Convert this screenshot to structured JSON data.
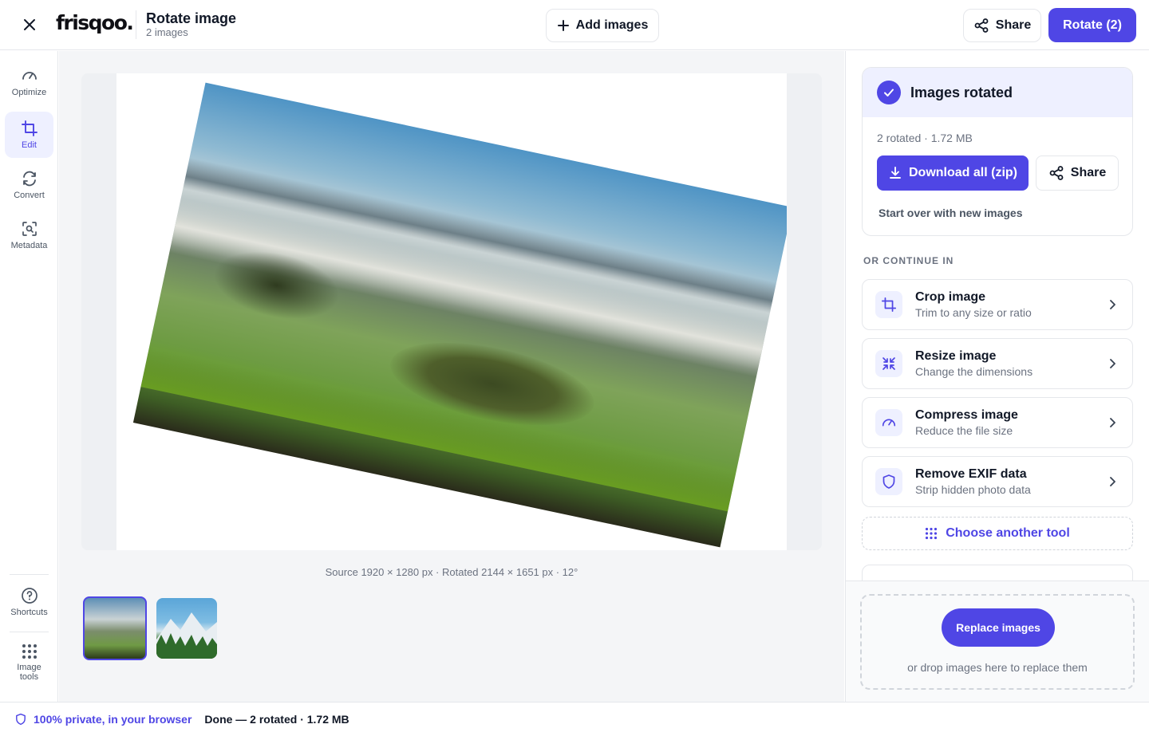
{
  "header": {
    "logo": "frisqoo.",
    "title": "Rotate image",
    "subtitle": "2 images",
    "add_images_label": "Add images",
    "share_label": "Share",
    "rotate_label": "Rotate (2)"
  },
  "rail": {
    "items": [
      {
        "label": "Optimize",
        "icon": "gauge-icon"
      },
      {
        "label": "Edit",
        "icon": "crop-icon",
        "active": true
      },
      {
        "label": "Convert",
        "icon": "refresh-icon"
      },
      {
        "label": "Metadata",
        "icon": "scan-search-icon"
      }
    ],
    "shortcuts_label": "Shortcuts",
    "tools_label_1": "Image",
    "tools_label_2": "tools"
  },
  "preview": {
    "dims_text": "Source 1920 × 1280 px · Rotated 2144 × 1651 px · 12°",
    "rotation_deg": 12,
    "thumbnails": [
      {
        "name": "misty-landscape",
        "selected": true
      },
      {
        "name": "mountain-forest",
        "selected": false
      }
    ]
  },
  "panel": {
    "status_title": "Images rotated",
    "status_meta": "2 rotated · 1.72 MB",
    "download_label": "Download all (zip)",
    "share_label": "Share",
    "start_over_label": "Start over with new images",
    "continue_label": "OR CONTINUE IN",
    "tools": [
      {
        "title": "Crop image",
        "sub": "Trim to any size or ratio",
        "icon": "crop-icon"
      },
      {
        "title": "Resize image",
        "sub": "Change the dimensions",
        "icon": "shrink-icon"
      },
      {
        "title": "Compress image",
        "sub": "Reduce the file size",
        "icon": "gauge-icon"
      },
      {
        "title": "Remove EXIF data",
        "sub": "Strip hidden photo data",
        "icon": "shield-icon"
      }
    ],
    "choose_tool_label": "Choose another tool",
    "replace_label": "Replace images",
    "drop_hint": "or drop images here to replace them"
  },
  "footer": {
    "private_label": "100% private, in your browser",
    "status": "Done — 2 rotated · 1.72 MB"
  },
  "colors": {
    "accent": "#4f46e5",
    "accent_light": "#eef0ff"
  }
}
